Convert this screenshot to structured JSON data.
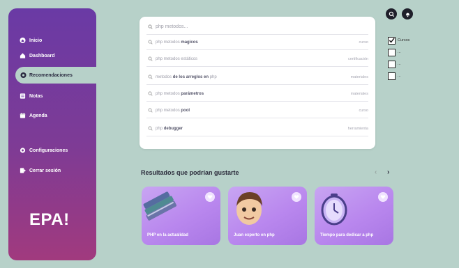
{
  "sidebar": {
    "items": [
      {
        "label": "Inicio",
        "icon": "home-icon",
        "active": false
      },
      {
        "label": "Dashboard",
        "icon": "dashboard-icon",
        "active": false
      },
      {
        "label": "Recomendaciones",
        "icon": "recommendations-icon",
        "active": true
      },
      {
        "label": "Notas",
        "icon": "notes-icon",
        "active": false
      },
      {
        "label": "Agenda",
        "icon": "calendar-icon",
        "active": false
      },
      {
        "label": "Configuraciones",
        "icon": "gear-icon",
        "active": false
      },
      {
        "label": "Cerrar sesión",
        "icon": "logout-icon",
        "active": false
      }
    ],
    "logo": "EPA!"
  },
  "search": {
    "value": "php metodos...",
    "suggestions": [
      {
        "prefix": "php metodos ",
        "bold": "magicos",
        "suffix": "",
        "category": "curso"
      },
      {
        "prefix": "php metodos estáticos",
        "bold": "",
        "suffix": "",
        "category": "certificación"
      },
      {
        "prefix": "metodos ",
        "bold": "de los arreglos en",
        "suffix": " php",
        "category": "materiales"
      },
      {
        "prefix": "php metodos ",
        "bold": "parámetros",
        "suffix": "",
        "category": "materiales"
      },
      {
        "prefix": "php metodos ",
        "bold": "pool",
        "suffix": "",
        "category": "curso"
      },
      {
        "prefix": "php ",
        "bold": "debugger",
        "suffix": "",
        "category": "herramienta"
      }
    ]
  },
  "filters": [
    {
      "label": "Cursos",
      "checked": true
    },
    {
      "label": "...",
      "checked": false
    },
    {
      "label": "...",
      "checked": false
    },
    {
      "label": "...",
      "checked": false
    }
  ],
  "results": {
    "title": "Resultados que podrían gustarte",
    "cards": [
      {
        "label": "PHP en la actualidad",
        "image": "books-illustration"
      },
      {
        "label": "Juan experto en php",
        "image": "avatar-illustration"
      },
      {
        "label": "Tiempo para dedicar a php",
        "image": "clock-illustration"
      }
    ]
  },
  "colors": {
    "background": "#b7d1c9",
    "sidebar_top": "#6a3aa5",
    "sidebar_bottom": "#a13a7e",
    "card": "#b987ee"
  }
}
